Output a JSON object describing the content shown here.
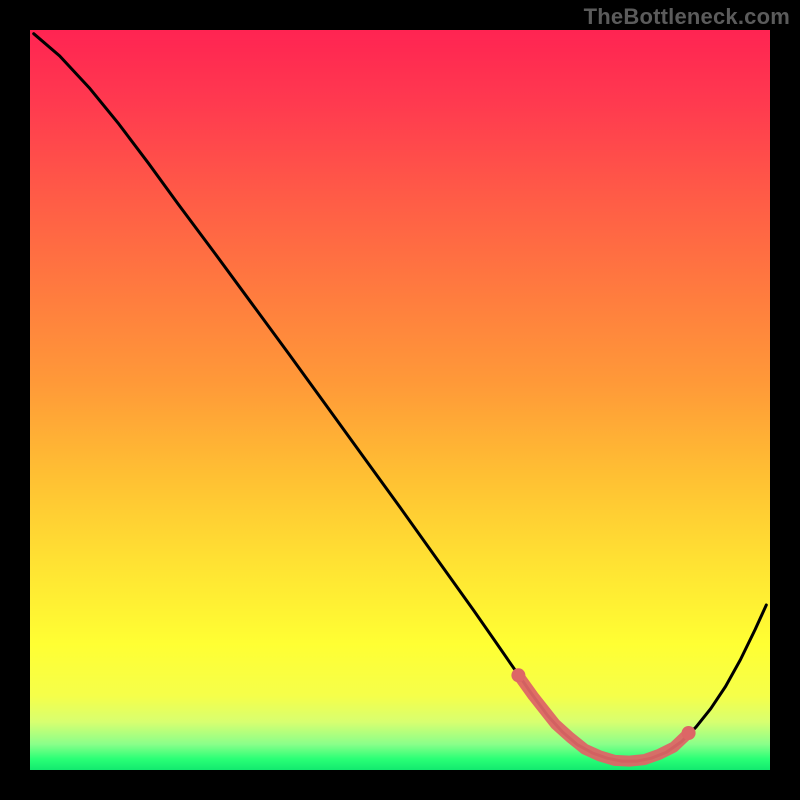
{
  "watermark": "TheBottleneck.com",
  "colors": {
    "background": "#000000",
    "curve": "#000000",
    "marker_fill": "#dd6666",
    "marker_stroke": "#cc5555",
    "gradient_stops": [
      {
        "offset": 0.0,
        "color": "#ff2452"
      },
      {
        "offset": 0.1,
        "color": "#ff3a4f"
      },
      {
        "offset": 0.22,
        "color": "#ff5a47"
      },
      {
        "offset": 0.35,
        "color": "#ff7a3f"
      },
      {
        "offset": 0.48,
        "color": "#ff9a38"
      },
      {
        "offset": 0.6,
        "color": "#ffbf33"
      },
      {
        "offset": 0.72,
        "color": "#ffe233"
      },
      {
        "offset": 0.83,
        "color": "#ffff33"
      },
      {
        "offset": 0.9,
        "color": "#f5ff4a"
      },
      {
        "offset": 0.935,
        "color": "#d8ff70"
      },
      {
        "offset": 0.965,
        "color": "#8aff8a"
      },
      {
        "offset": 0.985,
        "color": "#2aff76"
      },
      {
        "offset": 1.0,
        "color": "#12e96f"
      }
    ]
  },
  "chart_data": {
    "type": "line",
    "title": "",
    "xlabel": "",
    "ylabel": "",
    "xlim": [
      0,
      100
    ],
    "ylim": [
      0,
      100
    ],
    "series": [
      {
        "name": "curve",
        "x": [
          0.5,
          4,
          8,
          12,
          16,
          20,
          25,
          30,
          35,
          40,
          45,
          50,
          55,
          60,
          63,
          65,
          68,
          70,
          72,
          74,
          76,
          78,
          80,
          82,
          84,
          86,
          88,
          90,
          92,
          94,
          96,
          98,
          99.5
        ],
        "y": [
          99.5,
          96.5,
          92.2,
          87.3,
          82.0,
          76.5,
          69.8,
          63.0,
          56.2,
          49.3,
          42.4,
          35.5,
          28.5,
          21.5,
          17.2,
          14.3,
          10.0,
          7.3,
          5.1,
          3.4,
          2.3,
          1.6,
          1.2,
          1.2,
          1.6,
          2.4,
          3.8,
          5.8,
          8.3,
          11.3,
          14.9,
          19.0,
          22.3
        ]
      }
    ],
    "markers": {
      "name": "tolerance-band",
      "x": [
        66,
        68,
        71,
        73,
        75,
        77,
        79,
        81,
        83,
        85,
        87,
        89
      ],
      "y": [
        12.8,
        10.0,
        6.2,
        4.4,
        2.8,
        1.9,
        1.3,
        1.2,
        1.4,
        2.1,
        3.1,
        5.0
      ]
    }
  }
}
